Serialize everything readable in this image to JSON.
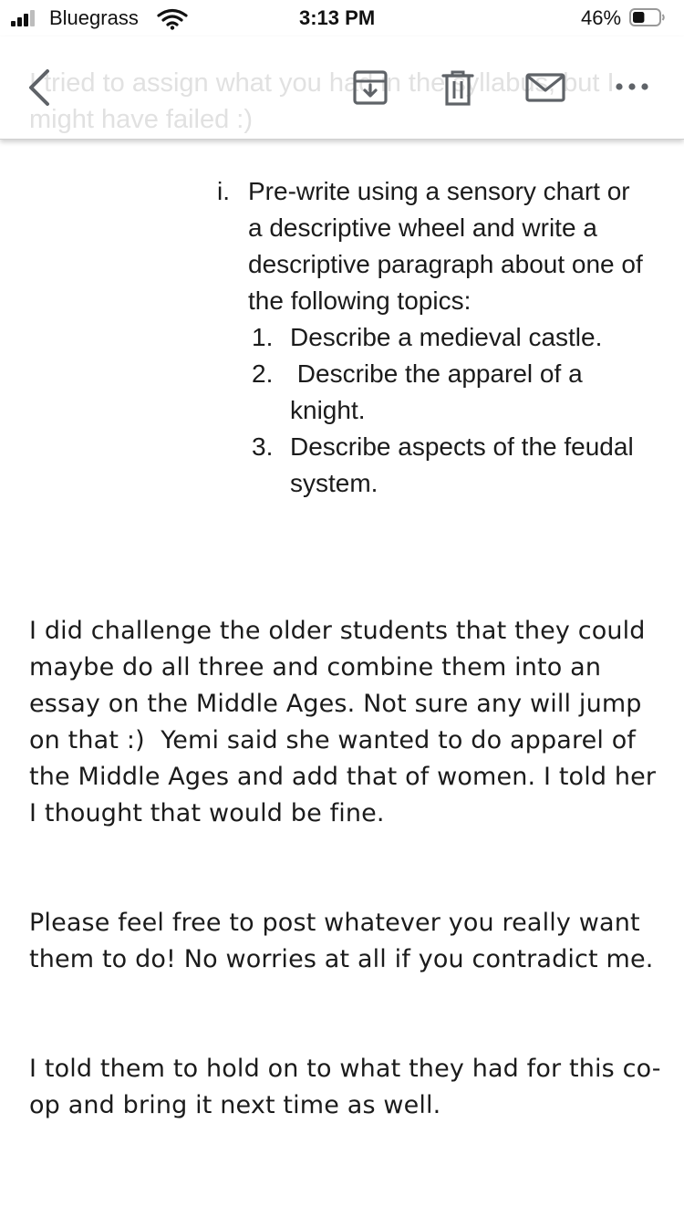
{
  "status_bar": {
    "carrier": "Bluegrass",
    "time": "3:13 PM",
    "battery_percent": "46%",
    "battery_level": 0.46,
    "signal_bars": 3
  },
  "toolbar": {
    "ghost_preview": "I tried to assign what you had in the syllabus, but I might have failed :)",
    "icons": {
      "back": "chevron-left-icon",
      "archive": "archive-icon",
      "delete": "trash-icon",
      "mark_unread": "mail-icon",
      "more": "more-icon"
    }
  },
  "message": {
    "assignment": {
      "marker": "i.",
      "text": "Pre-write using a sensory chart or a descriptive wheel and write a descriptive paragraph about one of the following topics:",
      "topics": [
        {
          "marker": "1.",
          "text": "Describe a medieval castle."
        },
        {
          "marker": "2.",
          "text": " Describe the apparel of a knight."
        },
        {
          "marker": "3.",
          "text": "Describe aspects of the feudal system."
        }
      ]
    },
    "paragraphs": [
      "I did challenge the older students that they could maybe do all three and combine them into an essay on the Middle Ages. Not sure any will jump on that :)  Yemi said she wanted to do apparel of the Middle Ages and add that of women. I told her I thought that would be fine.",
      "Please feel free to post whatever you really want them to do! No worries at all if you contradict me.",
      "I told them to hold on to what they had for this co-op and bring it next time as well."
    ]
  }
}
